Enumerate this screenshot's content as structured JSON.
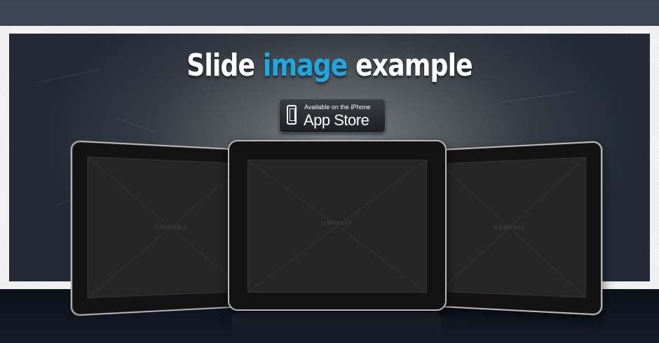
{
  "slide": {
    "title_part1": "Slide",
    "title_accent": "image",
    "title_part2": "example"
  },
  "app_store_badge": {
    "small_text": "Available on the iPhone",
    "big_text": "App Store"
  },
  "tablets": {
    "left_label": "GRAPHIX",
    "center_label": "GRAPHIX",
    "right_label": "GRAPHIX"
  },
  "colors": {
    "accent": "#1fa8e0",
    "frame": "#efefef",
    "background": "#2b3544"
  }
}
